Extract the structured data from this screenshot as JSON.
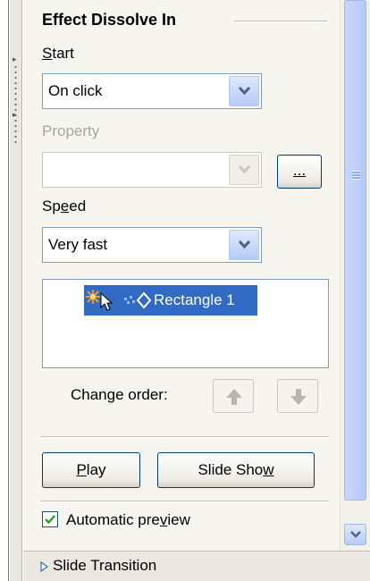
{
  "panel": {
    "title": "Effect Dissolve In",
    "start_label": "Start",
    "start_value": "On click",
    "property_label": "Property",
    "property_value": "",
    "ellipsis_label": "...",
    "speed_label": "Speed",
    "speed_value": "Very fast",
    "effects": [
      {
        "label": "Rectangle 1",
        "selected": true
      }
    ],
    "change_order_label": "Change order:",
    "play_label": "Play",
    "slide_show_label": "Slide Show",
    "automatic_preview_label": "Automatic preview",
    "automatic_preview_checked": true,
    "slide_transition_label": "Slide Transition"
  },
  "colors": {
    "selection": "#316ac5",
    "pane_bg": "#f6f5f0",
    "scroll_thumb": "#c1d3fb",
    "button_border": "#003c74"
  }
}
